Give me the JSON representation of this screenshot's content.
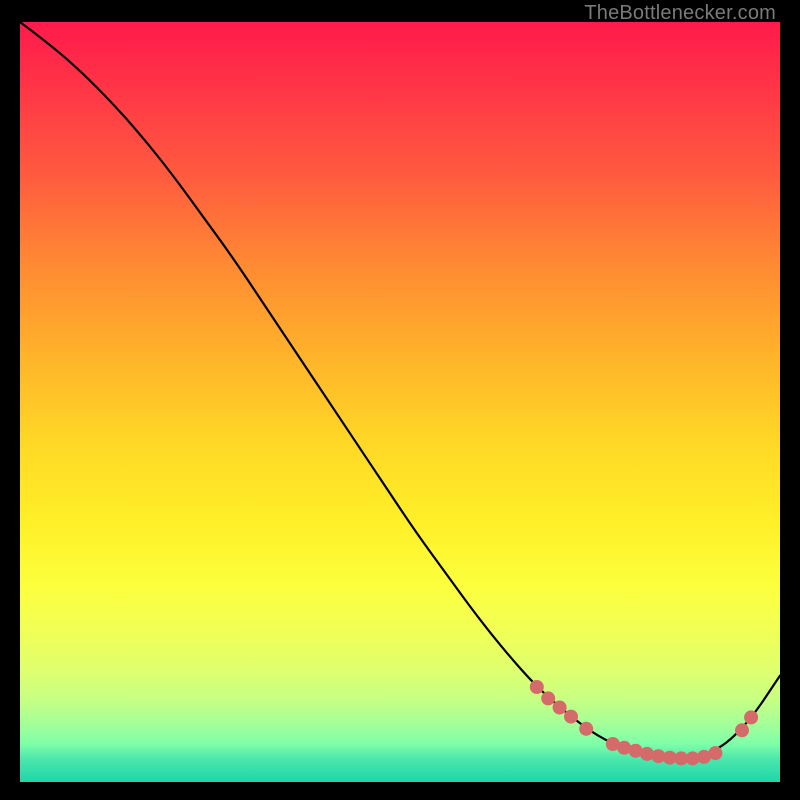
{
  "attribution": "TheBottlenecker.com",
  "colors": {
    "dot": "#d46a6a",
    "line": "#000000"
  },
  "chart_data": {
    "type": "line",
    "title": "",
    "xlabel": "",
    "ylabel": "",
    "xlim": [
      0,
      100
    ],
    "ylim": [
      0,
      100
    ],
    "grid": false,
    "legend": false,
    "series": [
      {
        "name": "curve",
        "x": [
          0,
          4,
          8,
          12,
          16,
          20,
          24,
          28,
          32,
          36,
          40,
          44,
          48,
          52,
          56,
          60,
          64,
          68,
          72,
          76,
          80,
          84,
          88,
          92,
          96,
          100
        ],
        "y": [
          100,
          97,
          93.5,
          89.5,
          85,
          80,
          74.5,
          69,
          63,
          57,
          51,
          45,
          39,
          33,
          27.5,
          22,
          17,
          12.5,
          9,
          6,
          4.2,
          3.3,
          3.1,
          4.2,
          8,
          14
        ]
      }
    ],
    "markers": [
      {
        "x": 68.0,
        "y": 12.5
      },
      {
        "x": 69.5,
        "y": 11.0
      },
      {
        "x": 71.0,
        "y": 9.8
      },
      {
        "x": 72.5,
        "y": 8.6
      },
      {
        "x": 74.5,
        "y": 7.0
      },
      {
        "x": 78.0,
        "y": 5.0
      },
      {
        "x": 79.5,
        "y": 4.5
      },
      {
        "x": 81.0,
        "y": 4.1
      },
      {
        "x": 82.5,
        "y": 3.7
      },
      {
        "x": 84.0,
        "y": 3.4
      },
      {
        "x": 85.5,
        "y": 3.2
      },
      {
        "x": 87.0,
        "y": 3.1
      },
      {
        "x": 88.5,
        "y": 3.1
      },
      {
        "x": 90.0,
        "y": 3.3
      },
      {
        "x": 91.5,
        "y": 3.8
      },
      {
        "x": 95.0,
        "y": 6.8
      },
      {
        "x": 96.2,
        "y": 8.5
      }
    ]
  }
}
